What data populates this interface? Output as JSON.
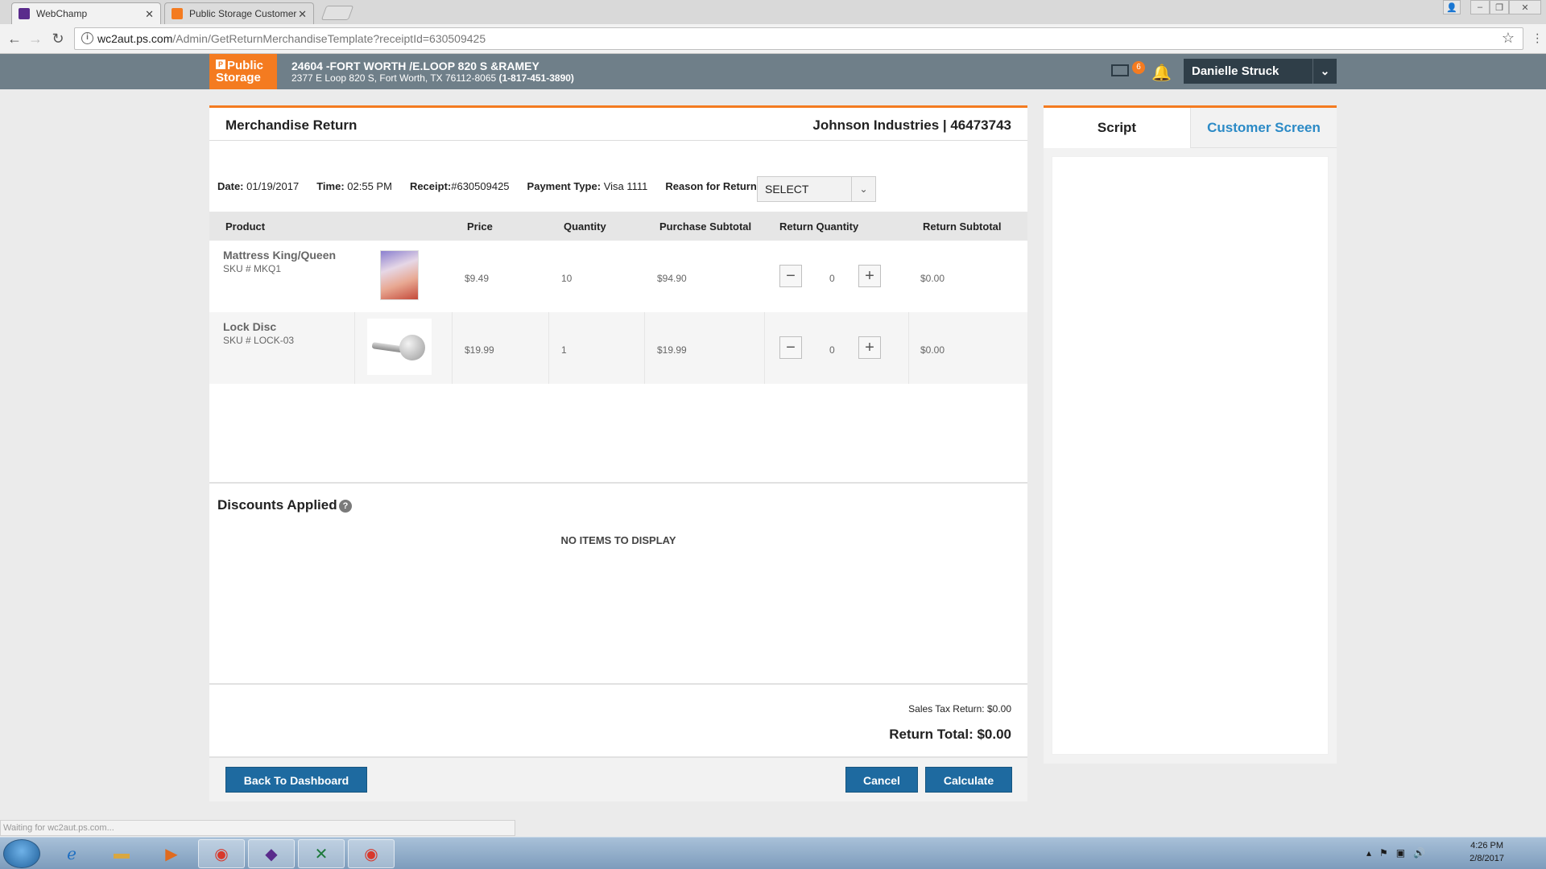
{
  "browser": {
    "tabs": [
      {
        "title": "WebChamp"
      },
      {
        "title": "Public Storage Customer"
      }
    ],
    "url_host": "wc2aut.ps.com",
    "url_path": "/Admin/GetReturnMerchandiseTemplate?receiptId=630509425",
    "status_text": "Waiting for wc2aut.ps.com..."
  },
  "header": {
    "logo_line1": "Public",
    "logo_line2": "Storage",
    "store_title": "24604 -FORT WORTH /E.LOOP 820 S &RAMEY",
    "store_address": "2377 E Loop 820 S, Fort Worth, TX 76112-8065",
    "store_phone": "(1-817-451-3890)",
    "mail_count": "6",
    "user_name": "Danielle Struck"
  },
  "panel": {
    "title": "Merchandise Return",
    "account": "Johnson Industries | 46473743",
    "date_label": "Date:",
    "date_value": "01/19/2017",
    "time_label": "Time:",
    "time_value": "02:55 PM",
    "receipt_label": "Receipt:",
    "receipt_value": "#630509425",
    "payment_label": "Payment Type:",
    "payment_value": "Visa 1111",
    "reason_label": "Reason for Return:",
    "reason_value": "SELECT"
  },
  "table": {
    "headers": [
      "Product",
      "Price",
      "Quantity",
      "Purchase Subtotal",
      "Return Quantity",
      "Return Subtotal"
    ],
    "rows": [
      {
        "name": "Mattress King/Queen",
        "sku": "SKU # MKQ1",
        "price": "$9.49",
        "quantity": "10",
        "purchase_subtotal": "$94.90",
        "return_quantity": "0",
        "return_subtotal": "$0.00"
      },
      {
        "name": "Lock Disc",
        "sku": "SKU # LOCK-03",
        "price": "$19.99",
        "quantity": "1",
        "purchase_subtotal": "$19.99",
        "return_quantity": "0",
        "return_subtotal": "$0.00"
      }
    ]
  },
  "discounts": {
    "title": "Discounts Applied",
    "empty_text": "NO ITEMS TO DISPLAY"
  },
  "totals": {
    "tax_text": "Sales Tax Return: $0.00",
    "total_text": "Return Total: $0.00"
  },
  "buttons": {
    "back": "Back To Dashboard",
    "cancel": "Cancel",
    "calculate": "Calculate"
  },
  "side": {
    "tab_script": "Script",
    "tab_customer": "Customer Screen"
  },
  "taskbar": {
    "time": "4:26 PM",
    "date": "2/8/2017"
  },
  "colors": {
    "brand_orange": "#f47b20",
    "header_slate": "#6f7f89",
    "button_blue": "#1e6aa0",
    "link_blue": "#2b8ac6"
  }
}
